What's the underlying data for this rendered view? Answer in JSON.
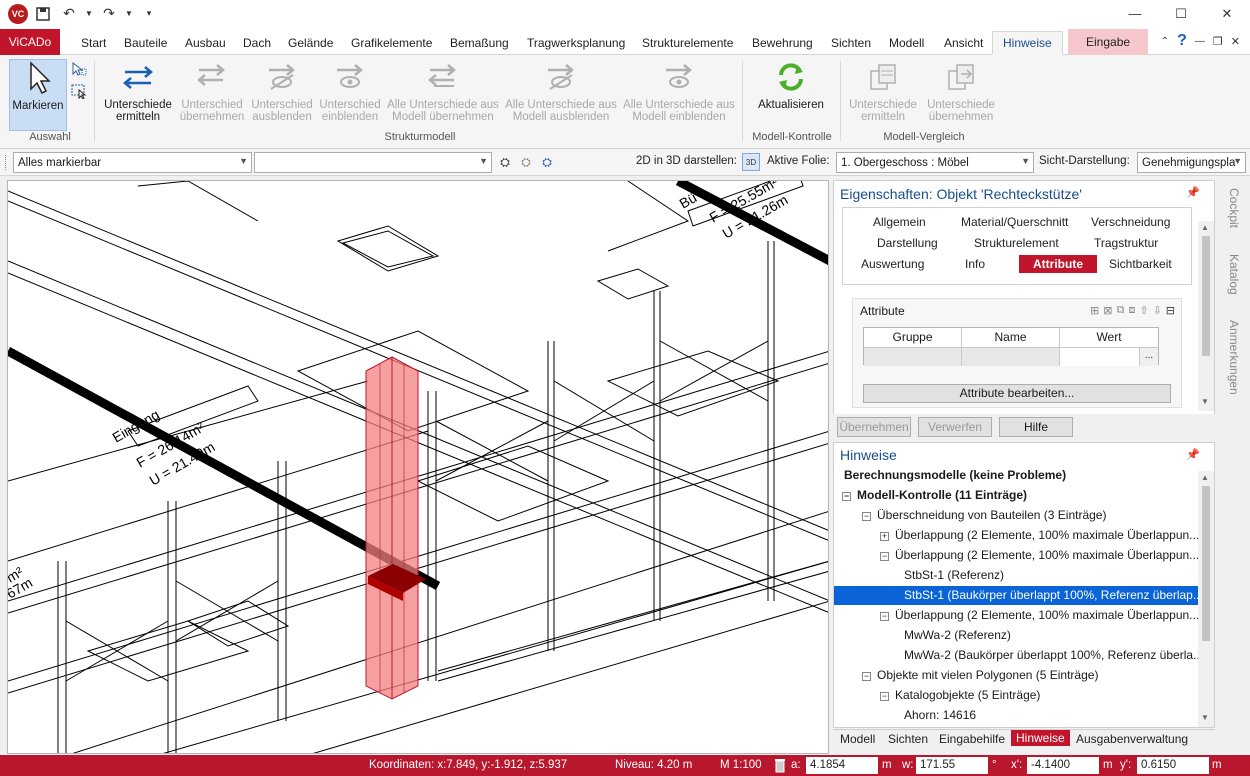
{
  "titlebar": {
    "app_logo": "VC",
    "quick_access": [
      "save-icon",
      "undo-icon",
      "redo-icon",
      "customize-icon"
    ]
  },
  "menu": {
    "app_button": "ViCADo",
    "tabs": [
      "Start",
      "Bauteile",
      "Ausbau",
      "Dach",
      "Gelände",
      "Grafikelemente",
      "Bemaßung",
      "Tragwerksplanung",
      "Strukturelemente",
      "Bewehrung",
      "Sichten",
      "Modell",
      "Ansicht",
      "Hinweise",
      "Eingabe"
    ],
    "active_tab": "Hinweise"
  },
  "ribbon": {
    "markieren": "Markieren",
    "auswahl_group": "Auswahl",
    "unterschiede_ermitteln": [
      "Unterschiede",
      "ermitteln"
    ],
    "unterschied_uebernehmen": [
      "Unterschied",
      "übernehmen"
    ],
    "unterschied_ausblenden": [
      "Unterschied",
      "ausblenden"
    ],
    "unterschied_einblenden": [
      "Unterschied",
      "einblenden"
    ],
    "alle_uebernehmen": [
      "Alle Unterschiede aus",
      "Modell übernehmen"
    ],
    "alle_ausblenden": [
      "Alle Unterschiede aus",
      "Modell ausblenden"
    ],
    "alle_einblenden": [
      "Alle Unterschiede aus",
      "Modell einblenden"
    ],
    "strukturmodell_group": "Strukturmodell",
    "aktualisieren": "Aktualisieren",
    "modell_kontrolle_group": "Modell-Kontrolle",
    "vergleich_ermitteln": [
      "Unterschiede",
      "ermitteln"
    ],
    "vergleich_uebernehmen": [
      "Unterschiede",
      "übernehmen"
    ],
    "modell_vergleich_group": "Modell-Vergleich"
  },
  "toolbar": {
    "filter_value": "Alles markierbar",
    "second_value": "",
    "label_2d3d": "2D in 3D darstellen:",
    "label_folie": "Aktive Folie:",
    "folie_value": "1. Obergeschoss : Möbel",
    "label_sicht": "Sicht-Darstellung:",
    "sicht_value": "Genehmigungspla"
  },
  "viewport": {
    "labels": [
      "Eingang",
      "F = 26.14m²",
      "U = 21.49m",
      "Bü",
      "F = 25.55m²",
      "U = 21.26m",
      "m²",
      "67m"
    ]
  },
  "properties": {
    "title": "Eigenschaften: Objekt 'Rechteckstütze'",
    "tabs_row1": [
      "Allgemein",
      "Material/Querschnitt",
      "Verschneidung"
    ],
    "tabs_row2": [
      "Darstellung",
      "Strukturelement",
      "Tragstruktur"
    ],
    "tabs_row3": [
      "Auswertung",
      "Info",
      "Attribute",
      "Sichtbarkeit"
    ],
    "active_tab": "Attribute",
    "attribute_label": "Attribute",
    "columns": [
      "Gruppe",
      "Name",
      "Wert"
    ],
    "ellipsis": "...",
    "edit_button": "Attribute bearbeiten..."
  },
  "actions": {
    "uebernehmen": "Übernehmen",
    "verwerfen": "Verwerfen",
    "hilfe": "Hilfe"
  },
  "hinweise": {
    "title": "Hinweise",
    "items": [
      {
        "text": "Berechnungsmodelle (keine Probleme)"
      },
      {
        "text": "Modell-Kontrolle (11 Einträge)"
      },
      {
        "text": "Überschneidung von Bauteilen (3 Einträge)"
      },
      {
        "text": "Überlappung (2 Elemente, 100% maximale Überlappun..."
      },
      {
        "text": "Überlappung (2 Elemente, 100% maximale Überlappun..."
      },
      {
        "text": "StbSt-1 (Referenz)"
      },
      {
        "text": "StbSt-1 (Baukörper überlappt 100%, Referenz überlap..."
      },
      {
        "text": "Überlappung (2 Elemente, 100% maximale Überlappun..."
      },
      {
        "text": "MwWa-2 (Referenz)"
      },
      {
        "text": "MwWa-2 (Baukörper überlappt 100%, Referenz überla..."
      },
      {
        "text": "Objekte mit vielen Polygonen (5 Einträge)"
      },
      {
        "text": "Katalogobjekte (5 Einträge)"
      },
      {
        "text": "Ahorn: 14616"
      }
    ]
  },
  "bottom_tabs": [
    "Modell",
    "Sichten",
    "Eingabehilfe",
    "Hinweise",
    "Ausgabenverwaltung"
  ],
  "bottom_active": "Hinweise",
  "side_tabs": [
    "Cockpit",
    "Katalog",
    "Anmerkungen"
  ],
  "status": {
    "koordinaten": "Koordinaten: x:7.849, y:-1.912, z:5.937",
    "niveau": "Niveau: 4.20 m",
    "massstab": "M 1:100",
    "a_label": "a:",
    "a_value": "4.1854",
    "a_unit": "m",
    "w_label": "w:",
    "w_value": "171.55",
    "w_unit": "°",
    "x_label": "x':",
    "x_value": "-4.1400",
    "x_unit": "m",
    "y_label": "y':",
    "y_value": "0.6150",
    "y_unit": "m"
  },
  "colors": {
    "brand_red": "#c0152b",
    "selection_blue": "#0a64d8",
    "column_highlight": "#f08080"
  }
}
